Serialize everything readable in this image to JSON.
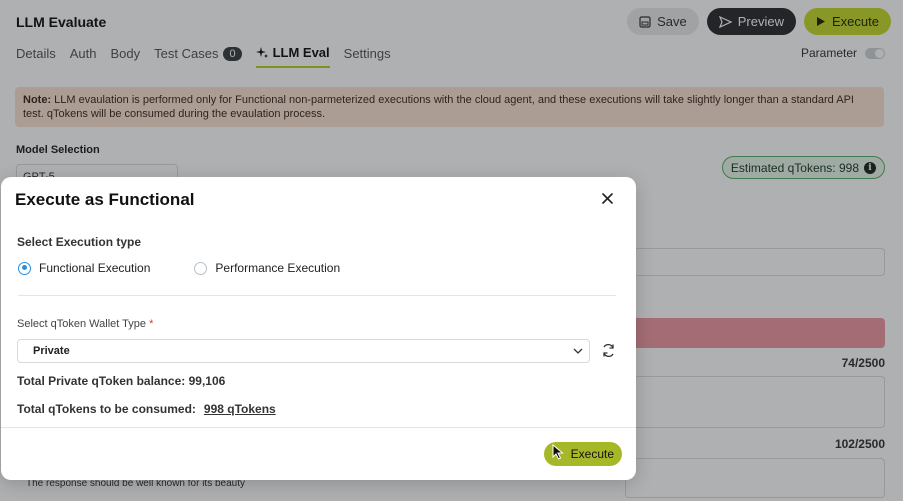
{
  "app": {
    "title": "LLM Evaluate"
  },
  "toolbar": {
    "save_label": "Save",
    "preview_label": "Preview",
    "execute_label": "Execute"
  },
  "tabs": [
    {
      "label": "Details"
    },
    {
      "label": "Auth"
    },
    {
      "label": "Body"
    },
    {
      "label": "Test Cases",
      "badge": "0"
    },
    {
      "label": "LLM Eval",
      "active": true
    },
    {
      "label": "Settings"
    }
  ],
  "parameter": {
    "label": "Parameter"
  },
  "note": {
    "prefix": "Note:",
    "text": " LLM evaulation is performed only for Functional non-parmeterized executions with the cloud agent, and these executions will take slightly longer than a standard API test. qTokens will be consumed during the evaulation process."
  },
  "model": {
    "label": "Model Selection",
    "value": "GPT-5"
  },
  "estimate": {
    "label": "Estimated qTokens: 998"
  },
  "counters": {
    "first": "74/2500",
    "second": "102/2500"
  },
  "background_text": "The response should be well known for its beauty",
  "modal": {
    "title": "Execute as Functional",
    "execution_type_label": "Select Execution type",
    "options": [
      {
        "label": "Functional Execution",
        "selected": true
      },
      {
        "label": "Performance Execution",
        "selected": false
      }
    ],
    "wallet_label": "Select qToken Wallet Type",
    "wallet_required": "*",
    "wallet_value": "Private",
    "balance_text": "Total Private qToken balance: 99,106",
    "consume_label": "Total qTokens to be consumed:",
    "consume_value": "998 qTokens",
    "execute_label": "Execute"
  },
  "colors": {
    "accent": "#c6da2e",
    "radio": "#2a8fe0",
    "badge_green": "#58b06a",
    "warning_bg": "#fbe3d4"
  }
}
